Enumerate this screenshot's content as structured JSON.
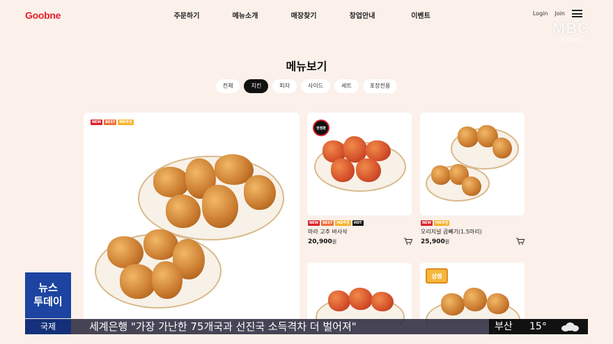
{
  "header": {
    "logo": "Goobne",
    "nav": [
      "주문하기",
      "메뉴소개",
      "매장찾기",
      "창업안내",
      "이벤트"
    ],
    "login": "Login",
    "join": "Join"
  },
  "broadcaster": {
    "logo": "MBC",
    "sub": "대전MBC"
  },
  "page": {
    "title": "메뉴보기",
    "tabs": [
      "전체",
      "치킨",
      "피자",
      "사이드",
      "세트",
      "포장전용"
    ],
    "active_tab": "치킨"
  },
  "featured": {
    "badges": [
      "NEW",
      "BEST",
      "MD추천"
    ]
  },
  "products": [
    {
      "tag": "한정판",
      "badges": [
        "NEW",
        "BEST",
        "MD추천",
        "HOT"
      ],
      "name": "마라 고추 바사삭",
      "price": "20,900",
      "unit": "원"
    },
    {
      "badges": [
        "NEW",
        "MD추천"
      ],
      "name": "오리지널 곱빼기(1.5마리)",
      "price": "25,900",
      "unit": "원"
    },
    {
      "tag": "샵셈"
    }
  ],
  "news": {
    "program": "뉴스\n투데이",
    "program_line1": "뉴스",
    "program_line2": "투데이",
    "category": "국제",
    "headline": "세계은행 \"가장 가난한 75개국과 선진국 소득격차 더 벌어져\"",
    "city": "부산",
    "temperature": "15°"
  },
  "colors": {
    "background": "#fbf0ea",
    "brand_red": "#e3202b",
    "news_blue": "#1c44a0"
  }
}
